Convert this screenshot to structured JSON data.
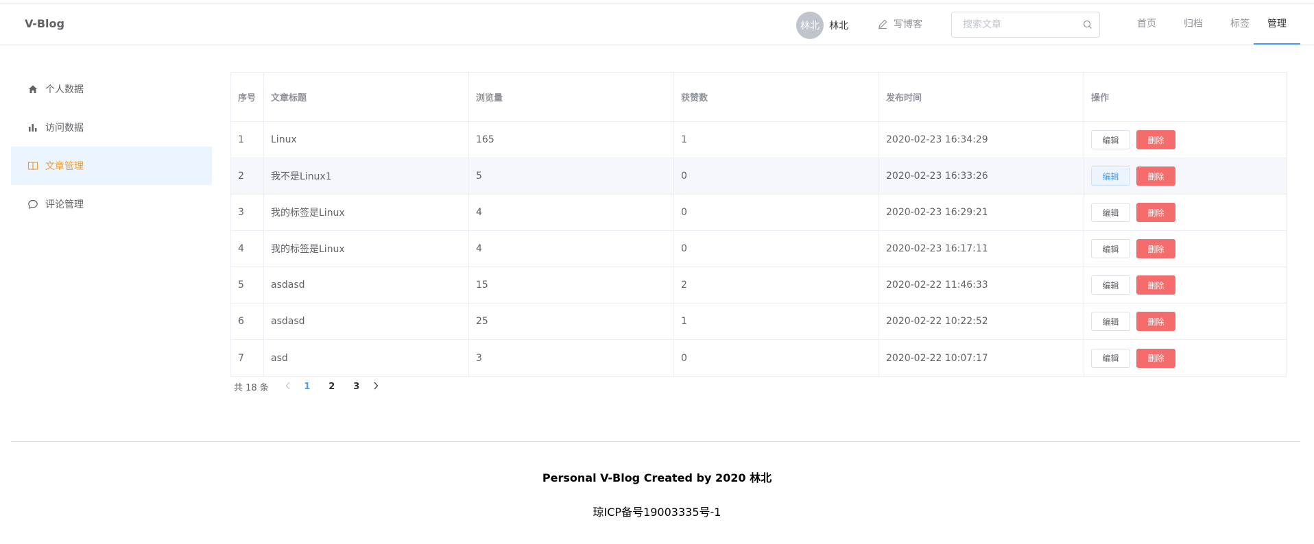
{
  "header": {
    "logo": "V-Blog",
    "user": {
      "avatar_text": "林北",
      "name": "林北"
    },
    "write_label": "写博客",
    "search_placeholder": "搜索文章",
    "nav": [
      {
        "label": "首页",
        "active": false
      },
      {
        "label": "归档",
        "active": false
      },
      {
        "label": "标签",
        "active": false
      },
      {
        "label": "管理",
        "active": true
      }
    ]
  },
  "sidebar": {
    "items": [
      {
        "label": "个人数据",
        "icon": "home-icon",
        "active": false
      },
      {
        "label": "访问数据",
        "icon": "bar-chart-icon",
        "active": false
      },
      {
        "label": "文章管理",
        "icon": "book-icon",
        "active": true
      },
      {
        "label": "评论管理",
        "icon": "comment-icon",
        "active": false
      }
    ]
  },
  "table": {
    "headers": [
      "序号",
      "文章标题",
      "浏览量",
      "获赞数",
      "发布时间",
      "操作"
    ],
    "edit_label": "编辑",
    "delete_label": "删除",
    "rows": [
      {
        "index": "1",
        "title": "Linux",
        "views": "165",
        "likes": "1",
        "date": "2020-02-23 16:34:29"
      },
      {
        "index": "2",
        "title": "我不是Linux1",
        "views": "5",
        "likes": "0",
        "date": "2020-02-23 16:33:26"
      },
      {
        "index": "3",
        "title": "我的标签是Linux",
        "views": "4",
        "likes": "0",
        "date": "2020-02-23 16:29:21"
      },
      {
        "index": "4",
        "title": "我的标签是Linux",
        "views": "4",
        "likes": "0",
        "date": "2020-02-23 16:17:11"
      },
      {
        "index": "5",
        "title": "asdasd",
        "views": "15",
        "likes": "2",
        "date": "2020-02-22 11:46:33"
      },
      {
        "index": "6",
        "title": "asdasd",
        "views": "25",
        "likes": "1",
        "date": "2020-02-22 10:22:52"
      },
      {
        "index": "7",
        "title": "asd",
        "views": "3",
        "likes": "0",
        "date": "2020-02-22 10:07:17"
      }
    ]
  },
  "pagination": {
    "total_label": "共 18 条",
    "pages": [
      "1",
      "2",
      "3"
    ],
    "current": "1"
  },
  "footer": {
    "line1": "Personal V-Blog Created by 2020 林北",
    "line2": "琼ICP备号19003335号-1"
  },
  "colors": {
    "accent": "#409eff",
    "active_menu_text": "#e6a23c",
    "active_menu_bg": "#ecf5ff",
    "danger": "#f56c6c"
  }
}
